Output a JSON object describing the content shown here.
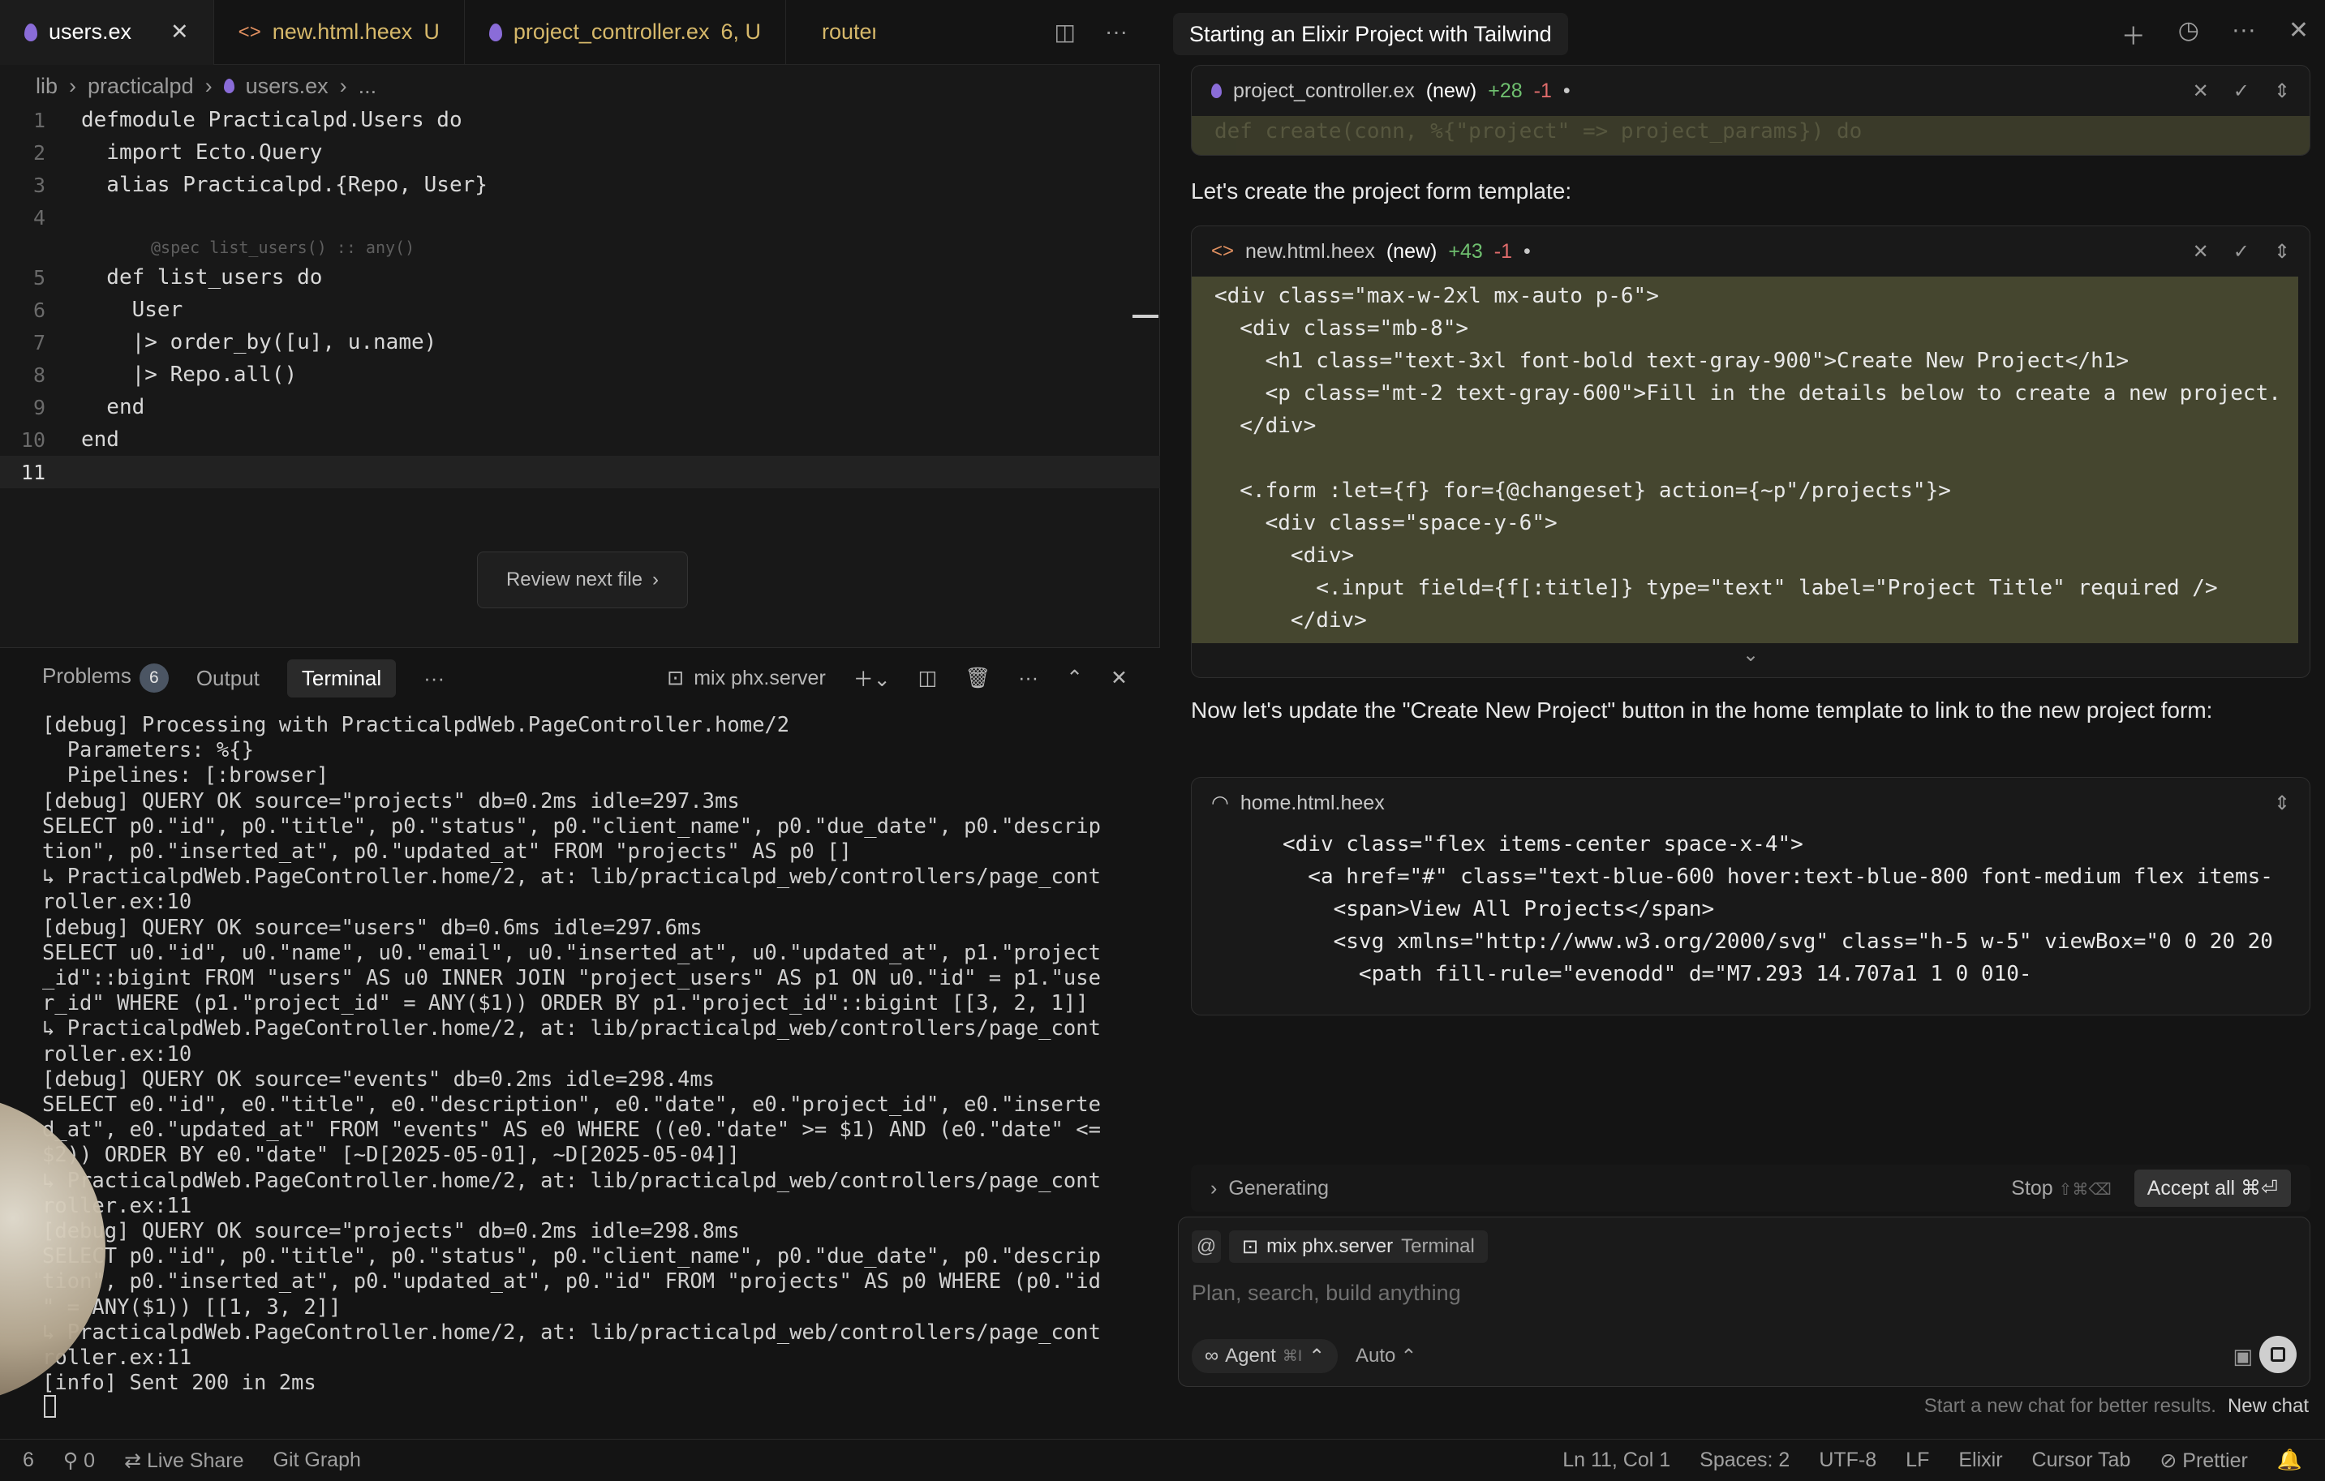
{
  "tabs": [
    {
      "label": "users.ex",
      "status": "",
      "icon": "drop",
      "active": true
    },
    {
      "label": "new.html.heex",
      "status": "U",
      "icon": "tag",
      "active": false
    },
    {
      "label": "project_controller.ex",
      "status": "6, U",
      "icon": "drop",
      "active": false
    },
    {
      "label": "router.e",
      "status": "",
      "icon": "drop",
      "active": false
    }
  ],
  "breadcrumb": {
    "part1": "lib",
    "part2": "practicalpd",
    "file": "users.ex",
    "more": "..."
  },
  "code": {
    "lines": [
      {
        "n": "1",
        "text": "defmodule Practicalpd.Users do"
      },
      {
        "n": "2",
        "text": "  import Ecto.Query"
      },
      {
        "n": "3",
        "text": "  alias Practicalpd.{Repo, User}"
      },
      {
        "n": "4",
        "text": ""
      },
      {
        "n": "5",
        "text": "  def list_users do"
      },
      {
        "n": "6",
        "text": "    User"
      },
      {
        "n": "7",
        "text": "    |> order_by([u], u.name)"
      },
      {
        "n": "8",
        "text": "    |> Repo.all()"
      },
      {
        "n": "9",
        "text": "  end"
      },
      {
        "n": "10",
        "text": "end"
      },
      {
        "n": "11",
        "text": ""
      }
    ],
    "spec_hint": "@spec list_users() :: any()"
  },
  "review_button": "Review next file",
  "panel": {
    "tabs": [
      "Problems",
      "Output",
      "Terminal"
    ],
    "problems_count": "6",
    "terminal_name": "mix phx.server",
    "terminal_lines": [
      "[debug] Processing with PracticalpdWeb.PageController.home/2",
      "  Parameters: %{}",
      "  Pipelines: [:browser]",
      "[debug] QUERY OK source=\"projects\" db=0.2ms idle=297.3ms",
      "SELECT p0.\"id\", p0.\"title\", p0.\"status\", p0.\"client_name\", p0.\"due_date\", p0.\"descrip",
      "tion\", p0.\"inserted_at\", p0.\"updated_at\" FROM \"projects\" AS p0 []",
      "↳ PracticalpdWeb.PageController.home/2, at: lib/practicalpd_web/controllers/page_cont",
      "roller.ex:10",
      "[debug] QUERY OK source=\"users\" db=0.6ms idle=297.6ms",
      "SELECT u0.\"id\", u0.\"name\", u0.\"email\", u0.\"inserted_at\", u0.\"updated_at\", p1.\"project",
      "_id\"::bigint FROM \"users\" AS u0 INNER JOIN \"project_users\" AS p1 ON u0.\"id\" = p1.\"use",
      "r_id\" WHERE (p1.\"project_id\" = ANY($1)) ORDER BY p1.\"project_id\"::bigint [[3, 2, 1]]",
      "↳ PracticalpdWeb.PageController.home/2, at: lib/practicalpd_web/controllers/page_cont",
      "roller.ex:10",
      "[debug] QUERY OK source=\"events\" db=0.2ms idle=298.4ms",
      "SELECT e0.\"id\", e0.\"title\", e0.\"description\", e0.\"date\", e0.\"project_id\", e0.\"inserte",
      "d_at\", e0.\"updated_at\" FROM \"events\" AS e0 WHERE ((e0.\"date\" >= $1) AND (e0.\"date\" <=",
      "$2)) ORDER BY e0.\"date\" [~D[2025-05-01], ~D[2025-05-04]]",
      "↳ PracticalpdWeb.PageController.home/2, at: lib/practicalpd_web/controllers/page_cont",
      "roller.ex:11",
      "[debug] QUERY OK source=\"projects\" db=0.2ms idle=298.8ms",
      "SELECT p0.\"id\", p0.\"title\", p0.\"status\", p0.\"client_name\", p0.\"due_date\", p0.\"descrip",
      "tion\", p0.\"inserted_at\", p0.\"updated_at\", p0.\"id\" FROM \"projects\" AS p0 WHERE (p0.\"id",
      "\" = ANY($1)) [[1, 3, 2]]",
      "↳ PracticalpdWeb.PageController.home/2, at: lib/practicalpd_web/controllers/page_cont",
      "roller.ex:11",
      "[info] Sent 200 in 2ms"
    ]
  },
  "chat": {
    "title": "Starting an Elixir Project with Tailwind",
    "card1": {
      "file": "project_controller.ex",
      "tag": "(new)",
      "added": "+28",
      "removed": "-1",
      "preview": "def create(conn, %{\"project\" => project_params}) do"
    },
    "msg1": "Let's create the project form template:",
    "card2": {
      "file": "new.html.heex",
      "tag": "(new)",
      "added": "+43",
      "removed": "-1",
      "lines": [
        "<div class=\"max-w-2xl mx-auto p-6\">",
        "  <div class=\"mb-8\">",
        "    <h1 class=\"text-3xl font-bold text-gray-900\">Create New Project</h1>",
        "    <p class=\"mt-2 text-gray-600\">Fill in the details below to create a new project.",
        "  </div>",
        "",
        "  <.form :let={f} for={@changeset} action={~p\"/projects\"}>",
        "    <div class=\"space-y-6\">",
        "      <div>",
        "        <.input field={f[:title]} type=\"text\" label=\"Project Title\" required />",
        "      </div>"
      ]
    },
    "msg2": "Now let's update the \"Create New Project\" button in the home template to link to the new project form:",
    "card3": {
      "file": "home.html.heex",
      "lines": [
        "<div class=\"flex items-center space-x-4\">",
        "  <a href=\"#\" class=\"text-blue-600 hover:text-blue-800 font-medium flex items-",
        "    <span>View All Projects</span>",
        "    <svg xmlns=\"http://www.w3.org/2000/svg\" class=\"h-5 w-5\" viewBox=\"0 0 20 20",
        "      <path fill-rule=\"evenodd\" d=\"M7.293 14.707a1 1 0 010-"
      ]
    },
    "generating": "Generating",
    "stop": "Stop",
    "stop_kbd": "⇧⌘⌫",
    "accept_all": "Accept all ⌘⏎",
    "context_chip": "mix phx.server",
    "context_chip_kind": "Terminal",
    "input_placeholder": "Plan, search, build anything",
    "mode": "Agent",
    "mode_kbd": "⌘I",
    "model": "Auto",
    "new_chat_hint": "Start a new chat for better results.",
    "new_chat": "New chat"
  },
  "statusbar": {
    "left": [
      "6",
      "0",
      "Live Share",
      "Git Graph"
    ],
    "right": [
      "Ln 11, Col 1",
      "Spaces: 2",
      "UTF-8",
      "LF",
      "Elixir",
      "Cursor Tab",
      "Prettier"
    ]
  }
}
